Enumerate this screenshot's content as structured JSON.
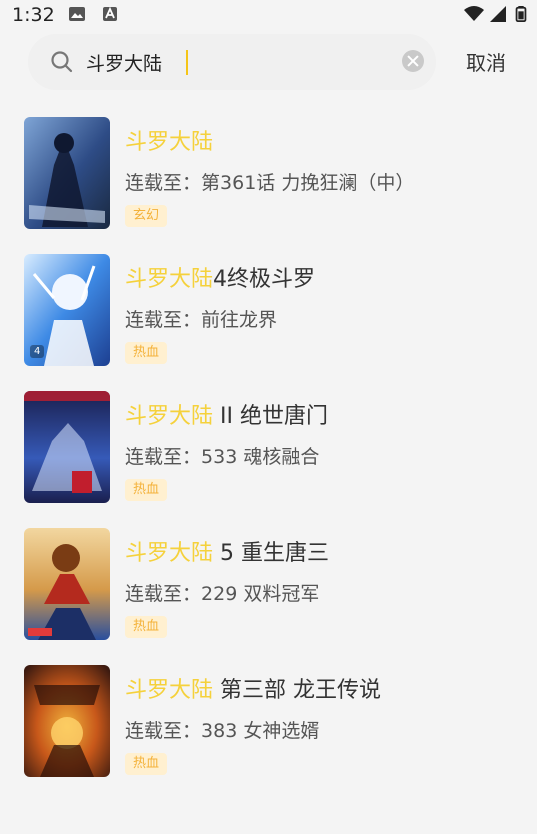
{
  "status_bar": {
    "time": "1:32"
  },
  "search": {
    "query": "斗罗大陆",
    "cancel_label": "取消"
  },
  "results": [
    {
      "title_highlight": "斗罗大陆",
      "title_rest": "",
      "subtitle_prefix": "连载至：",
      "subtitle": "第361话 力挽狂澜（中）",
      "tag": "玄幻",
      "cover_badge": "",
      "colors": [
        "#1a2940",
        "#2e4c86",
        "#7fa5d6"
      ]
    },
    {
      "title_highlight": "斗罗大陆",
      "title_rest": "4终极斗罗",
      "subtitle_prefix": "连载至：",
      "subtitle": "前往龙界",
      "tag": "热血",
      "cover_badge": "4",
      "colors": [
        "#1d3f91",
        "#3e8ae5",
        "#d8ecff"
      ]
    },
    {
      "title_highlight": "斗罗大陆",
      "title_rest": " II 绝世唐门",
      "subtitle_prefix": "连载至：",
      "subtitle": "533 魂核融合",
      "tag": "热血",
      "cover_badge": "",
      "colors": [
        "#1a1f4e",
        "#365ab8",
        "#c11e2d"
      ]
    },
    {
      "title_highlight": "斗罗大陆",
      "title_rest": " 5 重生唐三",
      "subtitle_prefix": "连载至：",
      "subtitle": "229 双料冠军",
      "tag": "热血",
      "cover_badge": "",
      "colors": [
        "#d59a4a",
        "#f2d7a0",
        "#294f9e"
      ]
    },
    {
      "title_highlight": "斗罗大陆",
      "title_rest": " 第三部 龙王传说",
      "subtitle_prefix": "连载至：",
      "subtitle": "383 女神选婿",
      "tag": "热血",
      "cover_badge": "",
      "colors": [
        "#3b1a10",
        "#c8581a",
        "#f0b23c"
      ]
    }
  ]
}
